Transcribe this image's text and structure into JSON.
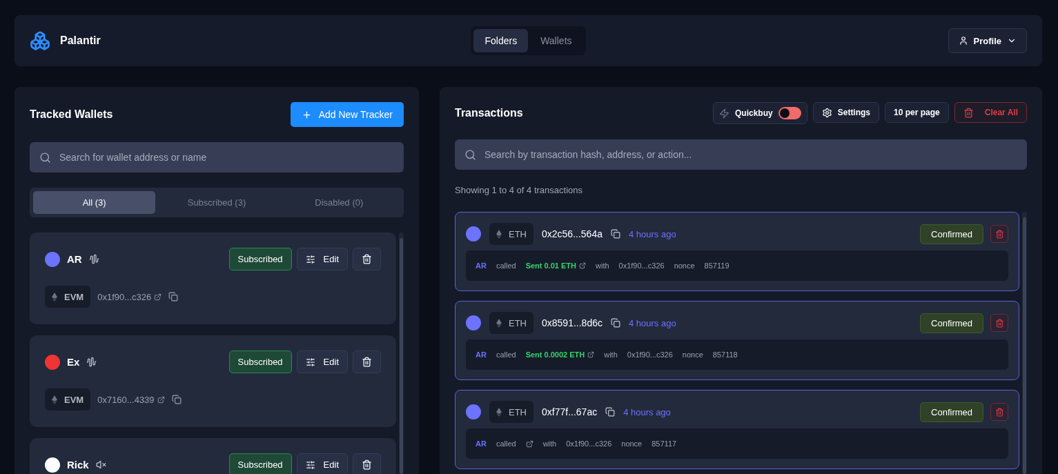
{
  "header": {
    "brand": "Palantir",
    "nav_tabs": [
      {
        "label": "Folders",
        "selected": true
      },
      {
        "label": "Wallets",
        "selected": false
      }
    ],
    "profile": "Profile"
  },
  "tracked_wallets": {
    "title": "Tracked Wallets",
    "add_button": "Add New Tracker",
    "search": {
      "placeholder": "Search for wallet address or name"
    },
    "filters": [
      {
        "label": "All (3)",
        "selected": true
      },
      {
        "label": "Subscribed (3)",
        "selected": false
      },
      {
        "label": "Disabled (0)",
        "selected": false
      }
    ],
    "wallets": [
      {
        "name": "AR",
        "color": "#6b73ff",
        "muted": false,
        "status": "Subscribed",
        "edit": "Edit",
        "chain": "EVM",
        "address": "0x1f90...c326"
      },
      {
        "name": "Ex",
        "color": "#ef3434",
        "muted": false,
        "status": "Subscribed",
        "edit": "Edit",
        "chain": "EVM",
        "address": "0x7160...4339"
      },
      {
        "name": "Rick",
        "color": "#ffffff",
        "muted": true,
        "status": "Subscribed",
        "edit": "Edit"
      }
    ]
  },
  "transactions": {
    "title": "Transactions",
    "quickbuy": {
      "label": "Quickbuy",
      "on": false
    },
    "settings": "Settings",
    "per_page": "10 per page",
    "clear_all": "Clear All",
    "search": {
      "placeholder": "Search by transaction hash, address, or action..."
    },
    "summary": "Showing 1 to 4 of 4 transactions",
    "items": [
      {
        "chain": "ETH",
        "hash": "0x2c56...564a",
        "time": "4 hours ago",
        "status": "Confirmed",
        "wallet": "AR",
        "verb": "called",
        "action": "Sent 0.01 ETH",
        "with_label": "with",
        "counterparty": "0x1f90...c326",
        "nonce_label": "nonce",
        "nonce": "857119"
      },
      {
        "chain": "ETH",
        "hash": "0x8591...8d6c",
        "time": "4 hours ago",
        "status": "Confirmed",
        "wallet": "AR",
        "verb": "called",
        "action": "Sent 0.0002 ETH",
        "with_label": "with",
        "counterparty": "0x1f90...c326",
        "nonce_label": "nonce",
        "nonce": "857118"
      },
      {
        "chain": "ETH",
        "hash": "0xf77f...67ac",
        "time": "4 hours ago",
        "status": "Confirmed",
        "wallet": "AR",
        "verb": "called",
        "with_label": "with",
        "counterparty": "0x1f90...c326",
        "nonce_label": "nonce",
        "nonce": "857117"
      }
    ]
  }
}
